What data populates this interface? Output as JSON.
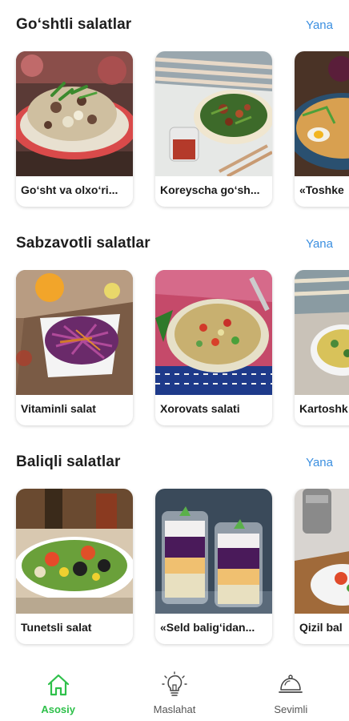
{
  "sections": [
    {
      "title": "Go‘shtli salatlar",
      "more": "Yana",
      "cards": [
        {
          "label": "Go‘sht va olxo‘ri..."
        },
        {
          "label": "Koreyscha go‘sh..."
        },
        {
          "label": "«Toshke"
        }
      ]
    },
    {
      "title": "Sabzavotli salatlar",
      "more": "Yana",
      "cards": [
        {
          "label": "Vitaminli salat"
        },
        {
          "label": "Xorovats salati"
        },
        {
          "label": "Kartoshk"
        }
      ]
    },
    {
      "title": "Baliqli salatlar",
      "more": "Yana",
      "cards": [
        {
          "label": "Tunetsli salat"
        },
        {
          "label": "«Seld balig‘idan..."
        },
        {
          "label": "Qizil bal"
        }
      ]
    }
  ],
  "nav": {
    "items": [
      {
        "label": "Asosiy",
        "icon": "home-icon",
        "active": true
      },
      {
        "label": "Maslahat",
        "icon": "lightbulb-icon",
        "active": false
      },
      {
        "label": "Sevimli",
        "icon": "cloche-icon",
        "active": false
      }
    ]
  },
  "colors": {
    "accent_link": "#3b8fe0",
    "active_nav": "#2ec04a",
    "text": "#1e1e1e"
  }
}
